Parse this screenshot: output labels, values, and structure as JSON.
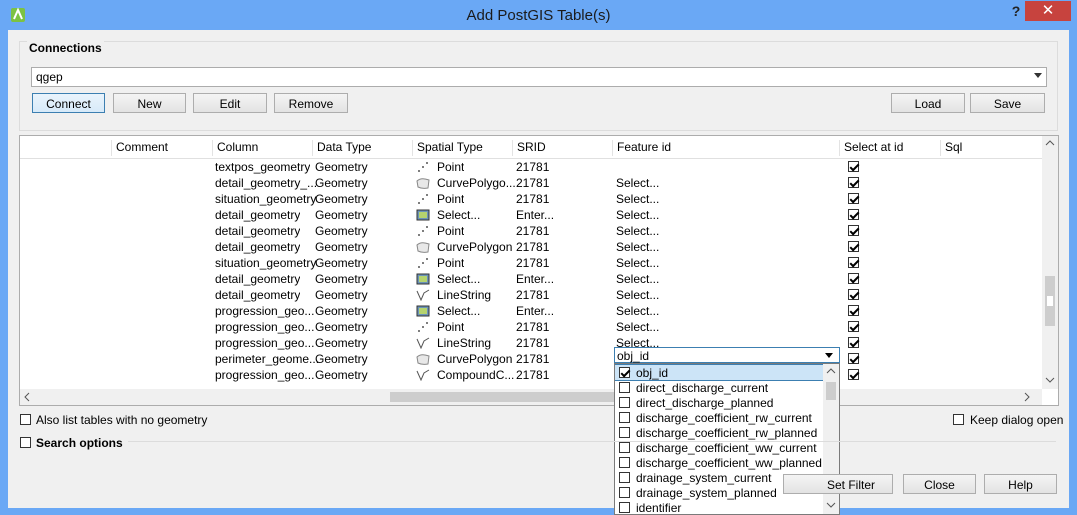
{
  "window": {
    "title": "Add PostGIS Table(s)",
    "help_label": "?",
    "close_label": "✕"
  },
  "connections": {
    "group_title": "Connections",
    "selected": "qgep",
    "buttons": {
      "connect": "Connect",
      "new": "New",
      "edit": "Edit",
      "remove": "Remove",
      "load": "Load",
      "save": "Save"
    }
  },
  "table": {
    "headers": [
      "Comment",
      "Column",
      "Data Type",
      "Spatial Type",
      "SRID",
      "Feature id",
      "Select at id",
      "Sql"
    ],
    "rows": [
      {
        "column": "textpos_geometry",
        "data_type": "Geometry",
        "geom_icon": "point-icon",
        "spatial_type": "Point",
        "srid": "21781",
        "feature_id": "",
        "select_at_id": true
      },
      {
        "column": "detail_geometry_...",
        "data_type": "Geometry",
        "geom_icon": "curvepolygon-icon",
        "spatial_type": "CurvePolygo...",
        "srid": "21781",
        "feature_id": "Select...",
        "select_at_id": true
      },
      {
        "column": "situation_geometry",
        "data_type": "Geometry",
        "geom_icon": "point-icon",
        "spatial_type": "Point",
        "srid": "21781",
        "feature_id": "Select...",
        "select_at_id": true
      },
      {
        "column": "detail_geometry",
        "data_type": "Geometry",
        "geom_icon": "raster-icon",
        "spatial_type": "Select...",
        "srid": "Enter...",
        "feature_id": "Select...",
        "select_at_id": true
      },
      {
        "column": "detail_geometry",
        "data_type": "Geometry",
        "geom_icon": "point-icon",
        "spatial_type": "Point",
        "srid": "21781",
        "feature_id": "Select...",
        "select_at_id": true
      },
      {
        "column": "detail_geometry",
        "data_type": "Geometry",
        "geom_icon": "curvepolygon-icon",
        "spatial_type": "CurvePolygon",
        "srid": "21781",
        "feature_id": "Select...",
        "select_at_id": true
      },
      {
        "column": "situation_geometry",
        "data_type": "Geometry",
        "geom_icon": "point-icon",
        "spatial_type": "Point",
        "srid": "21781",
        "feature_id": "Select...",
        "select_at_id": true
      },
      {
        "column": "detail_geometry",
        "data_type": "Geometry",
        "geom_icon": "raster-icon",
        "spatial_type": "Select...",
        "srid": "Enter...",
        "feature_id": "Select...",
        "select_at_id": true
      },
      {
        "column": "detail_geometry",
        "data_type": "Geometry",
        "geom_icon": "linestring-icon",
        "spatial_type": "LineString",
        "srid": "21781",
        "feature_id": "Select...",
        "select_at_id": true
      },
      {
        "column": "progression_geo...",
        "data_type": "Geometry",
        "geom_icon": "raster-icon",
        "spatial_type": "Select...",
        "srid": "Enter...",
        "feature_id": "Select...",
        "select_at_id": true
      },
      {
        "column": "progression_geo...",
        "data_type": "Geometry",
        "geom_icon": "point-icon",
        "spatial_type": "Point",
        "srid": "21781",
        "feature_id": "Select...",
        "select_at_id": true
      },
      {
        "column": "progression_geo...",
        "data_type": "Geometry",
        "geom_icon": "linestring-icon",
        "spatial_type": "LineString",
        "srid": "21781",
        "feature_id": "Select...",
        "select_at_id": true
      },
      {
        "column": "perimeter_geome...",
        "data_type": "Geometry",
        "geom_icon": "curvepolygon-icon",
        "spatial_type": "CurvePolygon",
        "srid": "21781",
        "feature_id": "obj_id",
        "select_at_id": true
      },
      {
        "column": "progression_geo...",
        "data_type": "Geometry",
        "geom_icon": "linestring-icon",
        "spatial_type": "CompoundC...",
        "srid": "21781",
        "feature_id": "",
        "select_at_id": true
      }
    ]
  },
  "feature_dropdown": {
    "value": "obj_id",
    "options": [
      {
        "label": "obj_id",
        "checked": true
      },
      {
        "label": "direct_discharge_current",
        "checked": false
      },
      {
        "label": "direct_discharge_planned",
        "checked": false
      },
      {
        "label": "discharge_coefficient_rw_current",
        "checked": false
      },
      {
        "label": "discharge_coefficient_rw_planned",
        "checked": false
      },
      {
        "label": "discharge_coefficient_ww_current",
        "checked": false
      },
      {
        "label": "discharge_coefficient_ww_planned",
        "checked": false
      },
      {
        "label": "drainage_system_current",
        "checked": false
      },
      {
        "label": "drainage_system_planned",
        "checked": false
      },
      {
        "label": "identifier",
        "checked": false
      }
    ]
  },
  "options": {
    "also_list_no_geometry": "Also list tables with no geometry",
    "keep_dialog_open": "Keep dialog open",
    "search_options": "Search options"
  },
  "bottom_buttons": {
    "set_filter": "Set Filter",
    "close": "Close",
    "help": "Help"
  }
}
